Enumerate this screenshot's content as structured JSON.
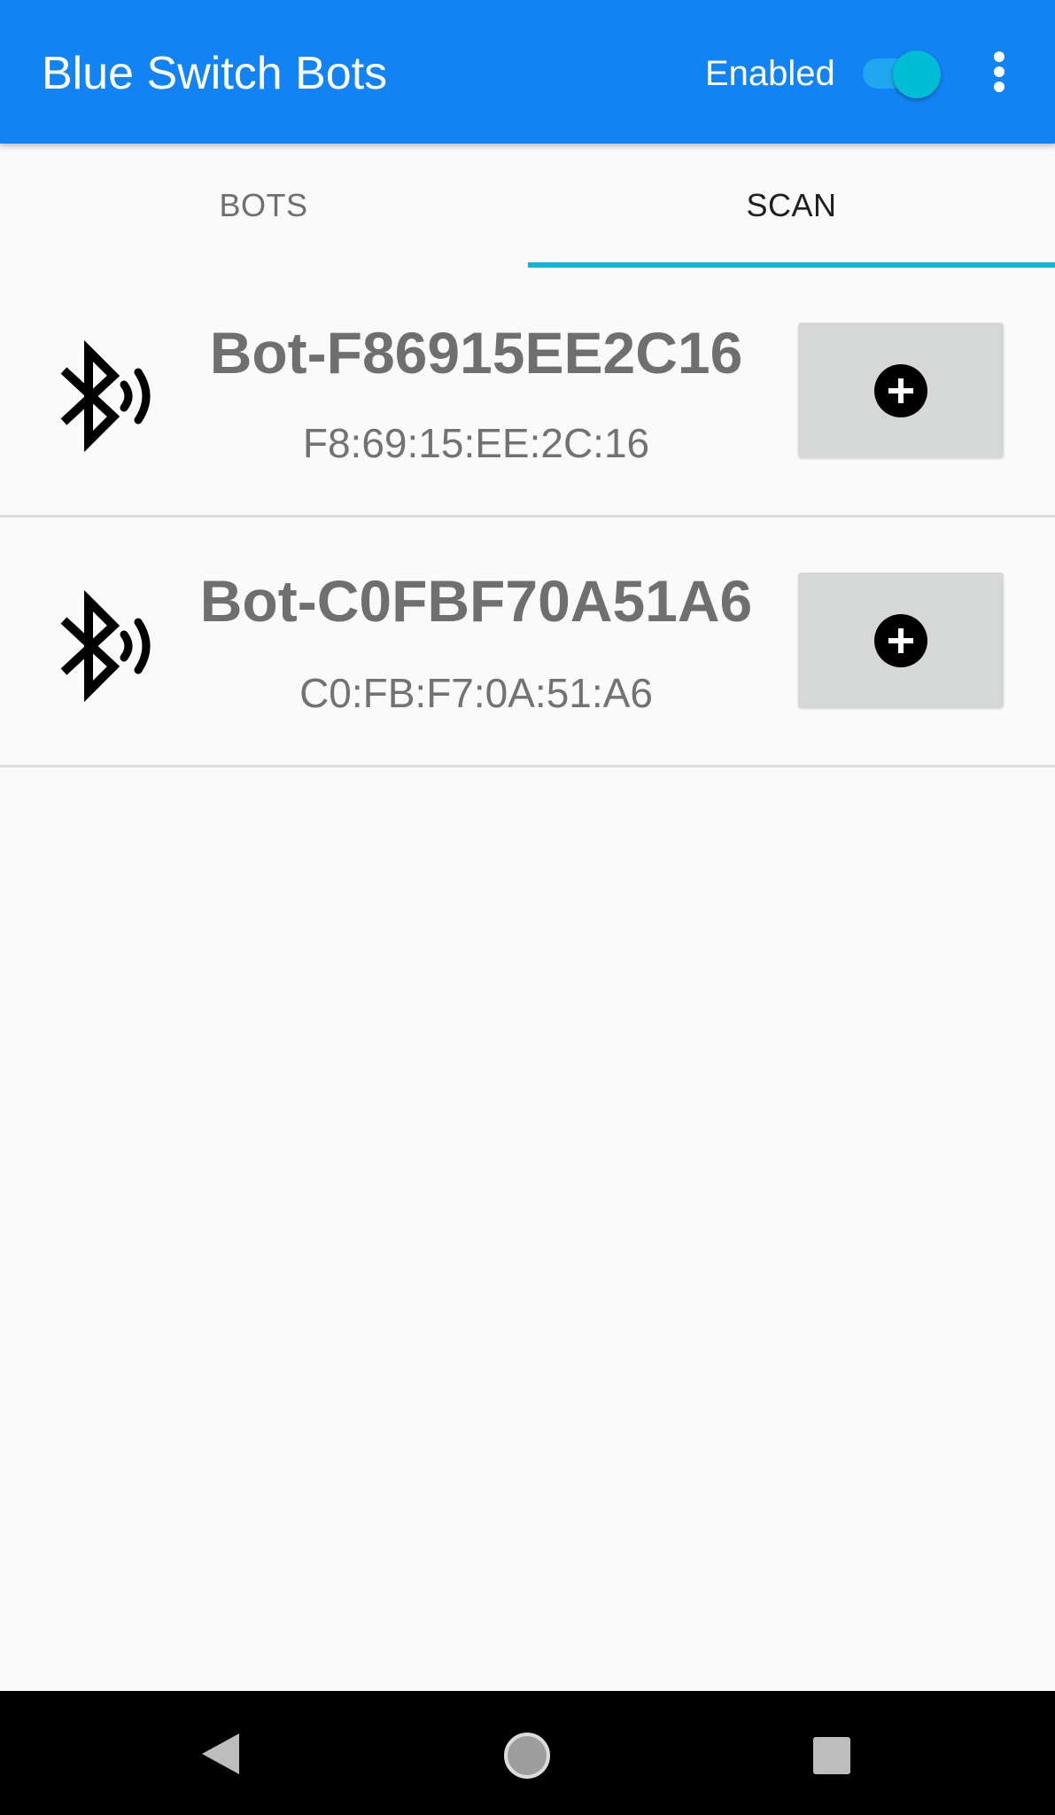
{
  "app_bar": {
    "title": "Blue Switch Bots",
    "enabled_label": "Enabled",
    "enabled": true,
    "overflow_icon": "more-vert-icon",
    "background_color": "#1283f4"
  },
  "tabs": [
    {
      "label": "BOTS",
      "selected": false
    },
    {
      "label": "SCAN",
      "selected": true
    }
  ],
  "accent_color": "#14b4d8",
  "scan_results": [
    {
      "name": "Bot-F86915EE2C16",
      "mac": "F8:69:15:EE:2C:16",
      "icon": "bluetooth-searching-icon",
      "action_icon": "add-circle-icon"
    },
    {
      "name": "Bot-C0FBF70A51A6",
      "mac": "C0:FB:F7:0A:51:A6",
      "icon": "bluetooth-searching-icon",
      "action_icon": "add-circle-icon"
    }
  ],
  "navigation_bar": {
    "buttons": [
      "back-icon",
      "home-icon",
      "recents-icon"
    ]
  }
}
